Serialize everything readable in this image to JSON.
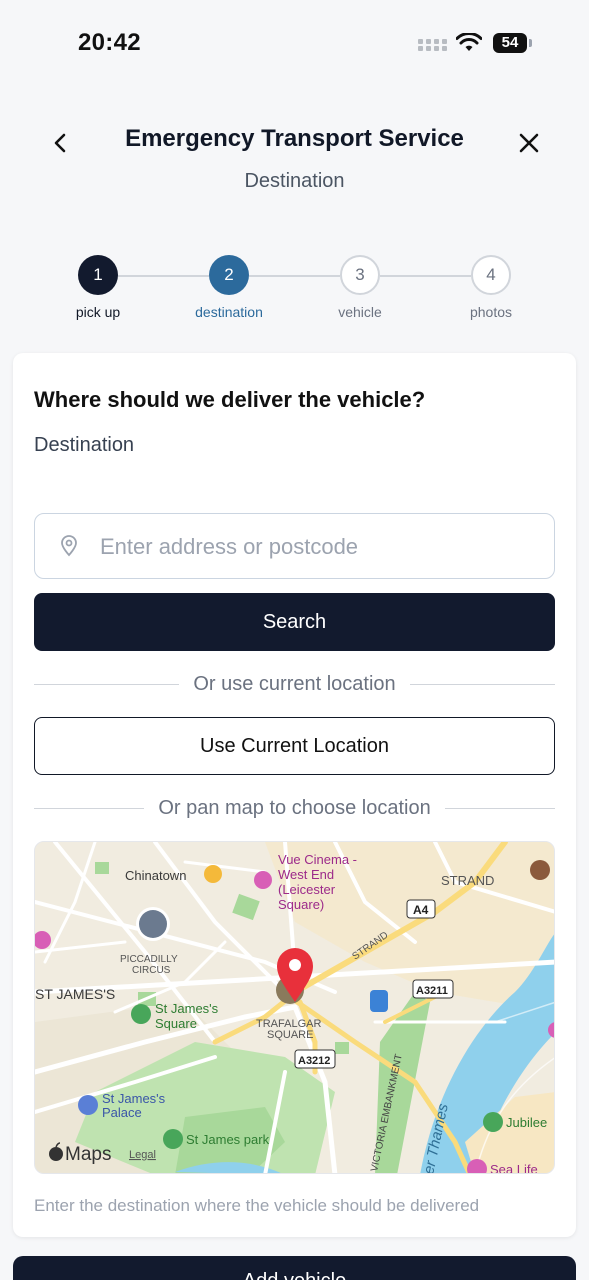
{
  "status_bar": {
    "time": "20:42",
    "battery": "54"
  },
  "header": {
    "title": "Emergency Transport Service",
    "subtitle": "Destination"
  },
  "stepper": {
    "steps": [
      {
        "number": "1",
        "label": "pick up",
        "state": "completed"
      },
      {
        "number": "2",
        "label": "destination",
        "state": "active"
      },
      {
        "number": "3",
        "label": "vehicle",
        "state": "upcoming"
      },
      {
        "number": "4",
        "label": "photos",
        "state": "upcoming"
      }
    ],
    "colors": {
      "completed": "#121a2e",
      "active": "#2c6a9c",
      "upcoming": "#ffffff"
    }
  },
  "form": {
    "question": "Where should we deliver the vehicle?",
    "destination_label": "Destination",
    "address_placeholder": "Enter address or postcode",
    "address_value": "",
    "search_label": "Search",
    "or_current_location": "Or use current location",
    "use_current_location_label": "Use Current Location",
    "or_pan_map": "Or pan map to choose location",
    "helper_text": "Enter the destination where the vehicle should be delivered"
  },
  "map": {
    "labels": {
      "chinatown": "Chinatown",
      "vue_cinema_1": "Vue Cinema -",
      "vue_cinema_2": "West End",
      "vue_cinema_3": "(Leicester",
      "vue_cinema_4": "Square)",
      "strand_1": "STRAND",
      "strand_2": "STRAND",
      "a4": "A4",
      "piccadilly_1": "PICCADILLY",
      "piccadilly_2": "CIRCUS",
      "st_james": "ST JAMES'S",
      "st_james_sq_1": "St James's",
      "st_james_sq_2": "Square",
      "trafalgar_1": "TRAFALGAR",
      "trafalgar_2": "SQUARE",
      "a3211": "A3211",
      "a3212": "A3212",
      "embankment": "VICTORIA EMBANKMENT",
      "thames": "er Thames",
      "palace_1": "St James's",
      "palace_2": "Palace",
      "park": "St James park",
      "jubilee": "Jubilee",
      "sea_life": "Sea Life",
      "maps_brand": "Maps",
      "legal": "Legal"
    },
    "colors": {
      "pin": "#e8303b",
      "water": "#8fd0ec",
      "park": "#a8d89a"
    }
  },
  "footer": {
    "primary_label": "Add vehicle"
  }
}
